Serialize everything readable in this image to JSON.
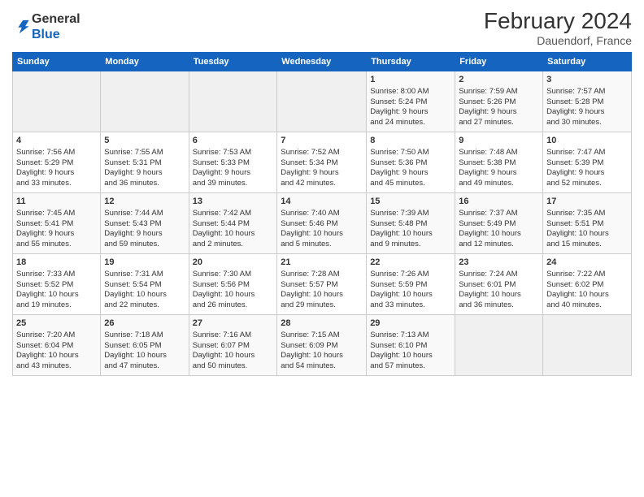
{
  "header": {
    "logo_line1": "General",
    "logo_line2": "Blue",
    "month": "February 2024",
    "location": "Dauendorf, France"
  },
  "days_of_week": [
    "Sunday",
    "Monday",
    "Tuesday",
    "Wednesday",
    "Thursday",
    "Friday",
    "Saturday"
  ],
  "weeks": [
    [
      {
        "day": "",
        "info": ""
      },
      {
        "day": "",
        "info": ""
      },
      {
        "day": "",
        "info": ""
      },
      {
        "day": "",
        "info": ""
      },
      {
        "day": "1",
        "info": "Sunrise: 8:00 AM\nSunset: 5:24 PM\nDaylight: 9 hours\nand 24 minutes."
      },
      {
        "day": "2",
        "info": "Sunrise: 7:59 AM\nSunset: 5:26 PM\nDaylight: 9 hours\nand 27 minutes."
      },
      {
        "day": "3",
        "info": "Sunrise: 7:57 AM\nSunset: 5:28 PM\nDaylight: 9 hours\nand 30 minutes."
      }
    ],
    [
      {
        "day": "4",
        "info": "Sunrise: 7:56 AM\nSunset: 5:29 PM\nDaylight: 9 hours\nand 33 minutes."
      },
      {
        "day": "5",
        "info": "Sunrise: 7:55 AM\nSunset: 5:31 PM\nDaylight: 9 hours\nand 36 minutes."
      },
      {
        "day": "6",
        "info": "Sunrise: 7:53 AM\nSunset: 5:33 PM\nDaylight: 9 hours\nand 39 minutes."
      },
      {
        "day": "7",
        "info": "Sunrise: 7:52 AM\nSunset: 5:34 PM\nDaylight: 9 hours\nand 42 minutes."
      },
      {
        "day": "8",
        "info": "Sunrise: 7:50 AM\nSunset: 5:36 PM\nDaylight: 9 hours\nand 45 minutes."
      },
      {
        "day": "9",
        "info": "Sunrise: 7:48 AM\nSunset: 5:38 PM\nDaylight: 9 hours\nand 49 minutes."
      },
      {
        "day": "10",
        "info": "Sunrise: 7:47 AM\nSunset: 5:39 PM\nDaylight: 9 hours\nand 52 minutes."
      }
    ],
    [
      {
        "day": "11",
        "info": "Sunrise: 7:45 AM\nSunset: 5:41 PM\nDaylight: 9 hours\nand 55 minutes."
      },
      {
        "day": "12",
        "info": "Sunrise: 7:44 AM\nSunset: 5:43 PM\nDaylight: 9 hours\nand 59 minutes."
      },
      {
        "day": "13",
        "info": "Sunrise: 7:42 AM\nSunset: 5:44 PM\nDaylight: 10 hours\nand 2 minutes."
      },
      {
        "day": "14",
        "info": "Sunrise: 7:40 AM\nSunset: 5:46 PM\nDaylight: 10 hours\nand 5 minutes."
      },
      {
        "day": "15",
        "info": "Sunrise: 7:39 AM\nSunset: 5:48 PM\nDaylight: 10 hours\nand 9 minutes."
      },
      {
        "day": "16",
        "info": "Sunrise: 7:37 AM\nSunset: 5:49 PM\nDaylight: 10 hours\nand 12 minutes."
      },
      {
        "day": "17",
        "info": "Sunrise: 7:35 AM\nSunset: 5:51 PM\nDaylight: 10 hours\nand 15 minutes."
      }
    ],
    [
      {
        "day": "18",
        "info": "Sunrise: 7:33 AM\nSunset: 5:52 PM\nDaylight: 10 hours\nand 19 minutes."
      },
      {
        "day": "19",
        "info": "Sunrise: 7:31 AM\nSunset: 5:54 PM\nDaylight: 10 hours\nand 22 minutes."
      },
      {
        "day": "20",
        "info": "Sunrise: 7:30 AM\nSunset: 5:56 PM\nDaylight: 10 hours\nand 26 minutes."
      },
      {
        "day": "21",
        "info": "Sunrise: 7:28 AM\nSunset: 5:57 PM\nDaylight: 10 hours\nand 29 minutes."
      },
      {
        "day": "22",
        "info": "Sunrise: 7:26 AM\nSunset: 5:59 PM\nDaylight: 10 hours\nand 33 minutes."
      },
      {
        "day": "23",
        "info": "Sunrise: 7:24 AM\nSunset: 6:01 PM\nDaylight: 10 hours\nand 36 minutes."
      },
      {
        "day": "24",
        "info": "Sunrise: 7:22 AM\nSunset: 6:02 PM\nDaylight: 10 hours\nand 40 minutes."
      }
    ],
    [
      {
        "day": "25",
        "info": "Sunrise: 7:20 AM\nSunset: 6:04 PM\nDaylight: 10 hours\nand 43 minutes."
      },
      {
        "day": "26",
        "info": "Sunrise: 7:18 AM\nSunset: 6:05 PM\nDaylight: 10 hours\nand 47 minutes."
      },
      {
        "day": "27",
        "info": "Sunrise: 7:16 AM\nSunset: 6:07 PM\nDaylight: 10 hours\nand 50 minutes."
      },
      {
        "day": "28",
        "info": "Sunrise: 7:15 AM\nSunset: 6:09 PM\nDaylight: 10 hours\nand 54 minutes."
      },
      {
        "day": "29",
        "info": "Sunrise: 7:13 AM\nSunset: 6:10 PM\nDaylight: 10 hours\nand 57 minutes."
      },
      {
        "day": "",
        "info": ""
      },
      {
        "day": "",
        "info": ""
      }
    ]
  ]
}
